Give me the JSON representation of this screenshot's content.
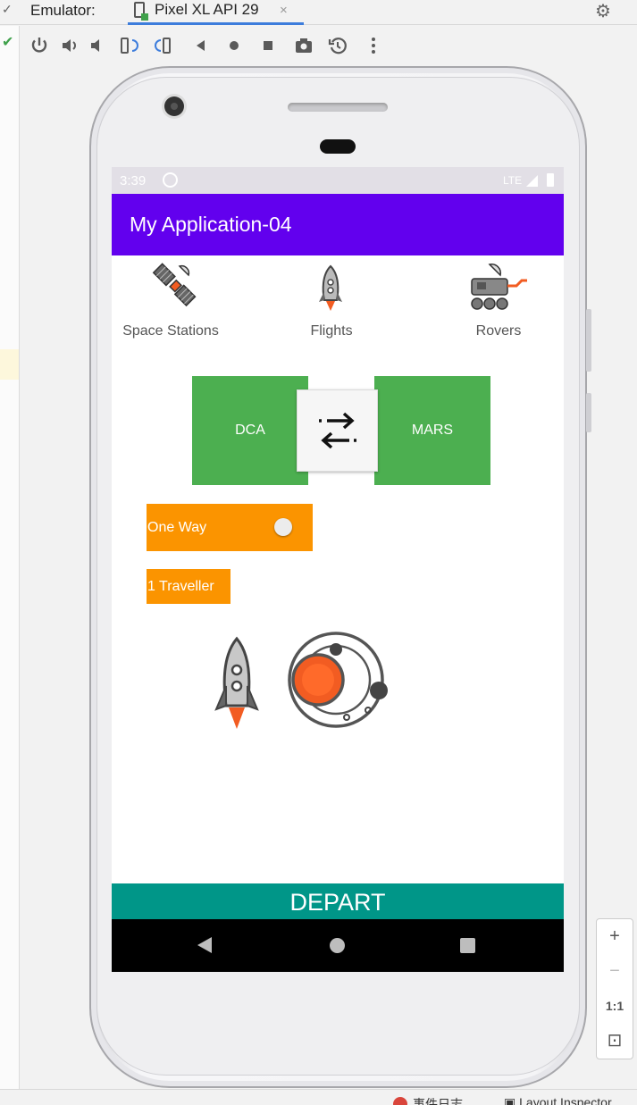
{
  "ide": {
    "emulator_label": "Emulator:",
    "device_tab": "Pixel XL API 29",
    "close_glyph": "×",
    "gear_glyph": "⚙",
    "toolbar_icons": [
      "power-icon",
      "volume-up-icon",
      "volume-down-icon",
      "rotate-left-icon",
      "rotate-right-icon",
      "back-icon",
      "home-icon",
      "overview-icon",
      "screenshot-icon",
      "snapshot-icon",
      "more-icon"
    ],
    "zoom": {
      "plus": "+",
      "minus": "−",
      "one_to_one": "1:1"
    },
    "bottom_items": [
      "事件日志",
      "Layout Inspector"
    ]
  },
  "phone_screen": {
    "status": {
      "time": "3:39",
      "network": "LTE"
    },
    "app_title": "My Application-04",
    "nav_items": [
      {
        "label": "Space Stations",
        "icon": "satellite-icon"
      },
      {
        "label": "Flights",
        "icon": "rocket-icon"
      },
      {
        "label": "Rovers",
        "icon": "rover-icon"
      }
    ],
    "origin_code": "DCA",
    "destination_code": "MARS",
    "swap_icon": "swap-arrows-icon",
    "trip_type": "One Way",
    "travellers": "1 Traveller",
    "illustrations": [
      "rocket-icon",
      "planet-orbit-icon"
    ],
    "depart_label": "DEPART"
  },
  "colors": {
    "app_bar": "#6200ee",
    "code_box": "#4caf50",
    "option_box": "#fb9400",
    "depart_button": "#009688",
    "rocket_flame": "#f25c22"
  }
}
